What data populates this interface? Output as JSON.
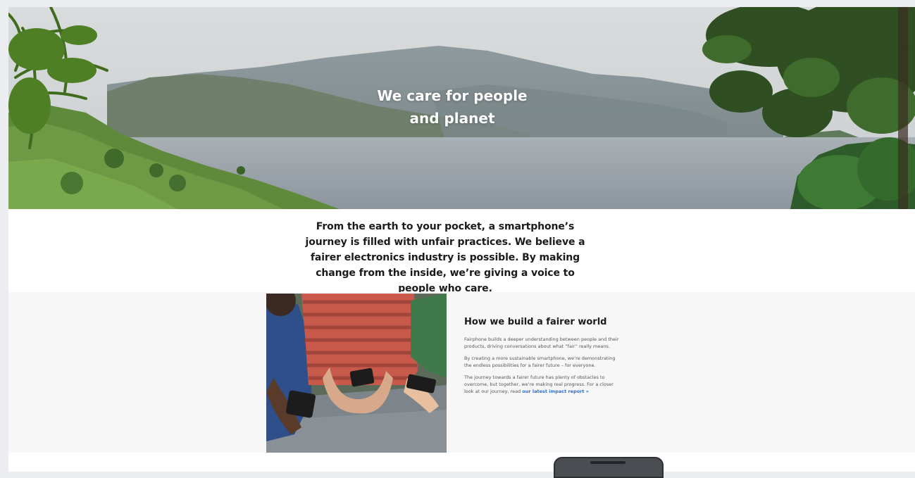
{
  "hero": {
    "title": "We care for people and planet",
    "image_icon": "lake-landscape-photo"
  },
  "intro": {
    "text": "From the earth to your pocket, a smartphone’s journey is filled with unfair practices. We believe a fairer electronics industry is possible. By making change from the inside, we’re giving a voice to people who care."
  },
  "feature": {
    "image_icon": "people-holding-phones-photo",
    "heading": "How we build a fairer world",
    "para1": "Fairphone builds a deeper understanding between people and their products, driving conversations about what “fair” really means.",
    "para2": "By creating a more sustainable smartphone, we’re demonstrating the endless possibilities for a fairer future – for everyone.",
    "para3": "The journey towards a fairer future has plenty of obstacles to overcome, but together, we’re making real progress. For a closer look at our journey, read ",
    "link_label": "our latest impact report »"
  },
  "colors": {
    "link": "#2f6fc7",
    "section_bg": "#f7f7f7",
    "text": "#1b1b1b"
  }
}
